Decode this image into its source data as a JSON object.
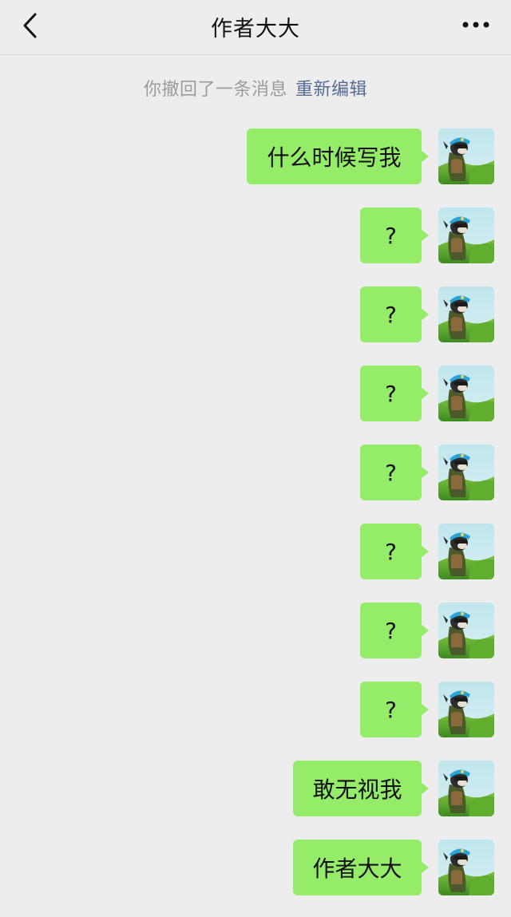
{
  "header": {
    "title": "作者大大",
    "back_icon": "chevron-left-icon",
    "more_icon": "more-horizontal-icon"
  },
  "system_notice": {
    "text": "你撤回了一条消息",
    "action": "重新编辑"
  },
  "messages": [
    {
      "text": "什么时候写我"
    },
    {
      "text": "?"
    },
    {
      "text": "?"
    },
    {
      "text": "?"
    },
    {
      "text": "?"
    },
    {
      "text": "?"
    },
    {
      "text": "?"
    },
    {
      "text": "?"
    },
    {
      "text": "敢无视我"
    },
    {
      "text": "作者大大"
    }
  ],
  "colors": {
    "bubble": "#95ec69",
    "background": "#ededed",
    "link": "#576b95"
  }
}
